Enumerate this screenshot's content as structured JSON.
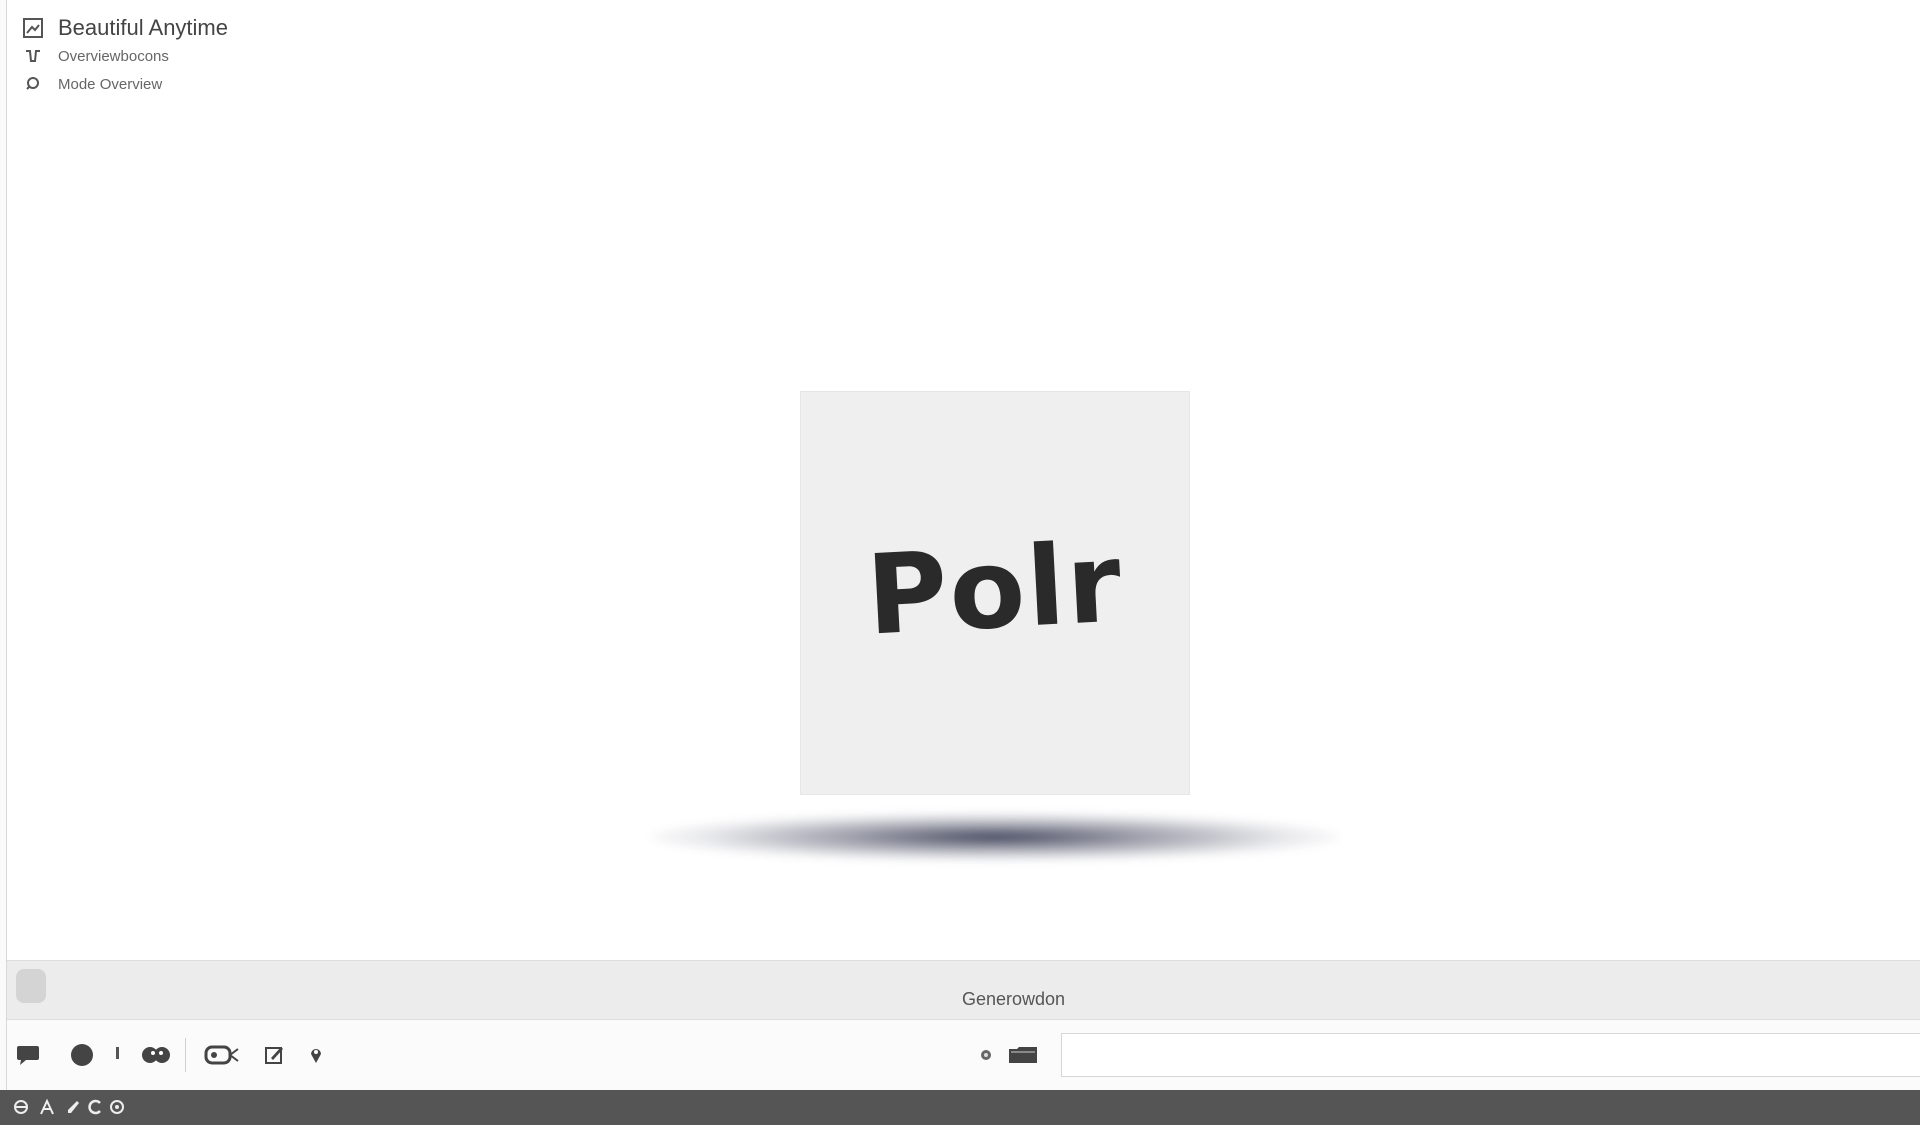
{
  "info_panel": {
    "title": "Beautiful Anytime",
    "line1": "Overviewbocons",
    "line2": "Mode Overview"
  },
  "canvas": {
    "word": "Polr"
  },
  "status_bar": {
    "text": "Generowdon"
  },
  "toolbar": {
    "icons": [
      "speech-bubble-icon",
      "circle-icon",
      "pin-icon",
      "group-icon",
      "tag-icon",
      "edit-icon",
      "location-icon",
      "dot-icon",
      "folder-icon"
    ],
    "input_value": ""
  },
  "taskbar": {
    "icons": [
      "globe-icon",
      "a-icon",
      "brush-icon",
      "c-icon",
      "settings-icon"
    ]
  },
  "colors": {
    "background": "#ffffff",
    "status_bar": "#ececec",
    "taskbar": "#555555",
    "canvas": "#efefef",
    "shadow": "#282c46"
  }
}
